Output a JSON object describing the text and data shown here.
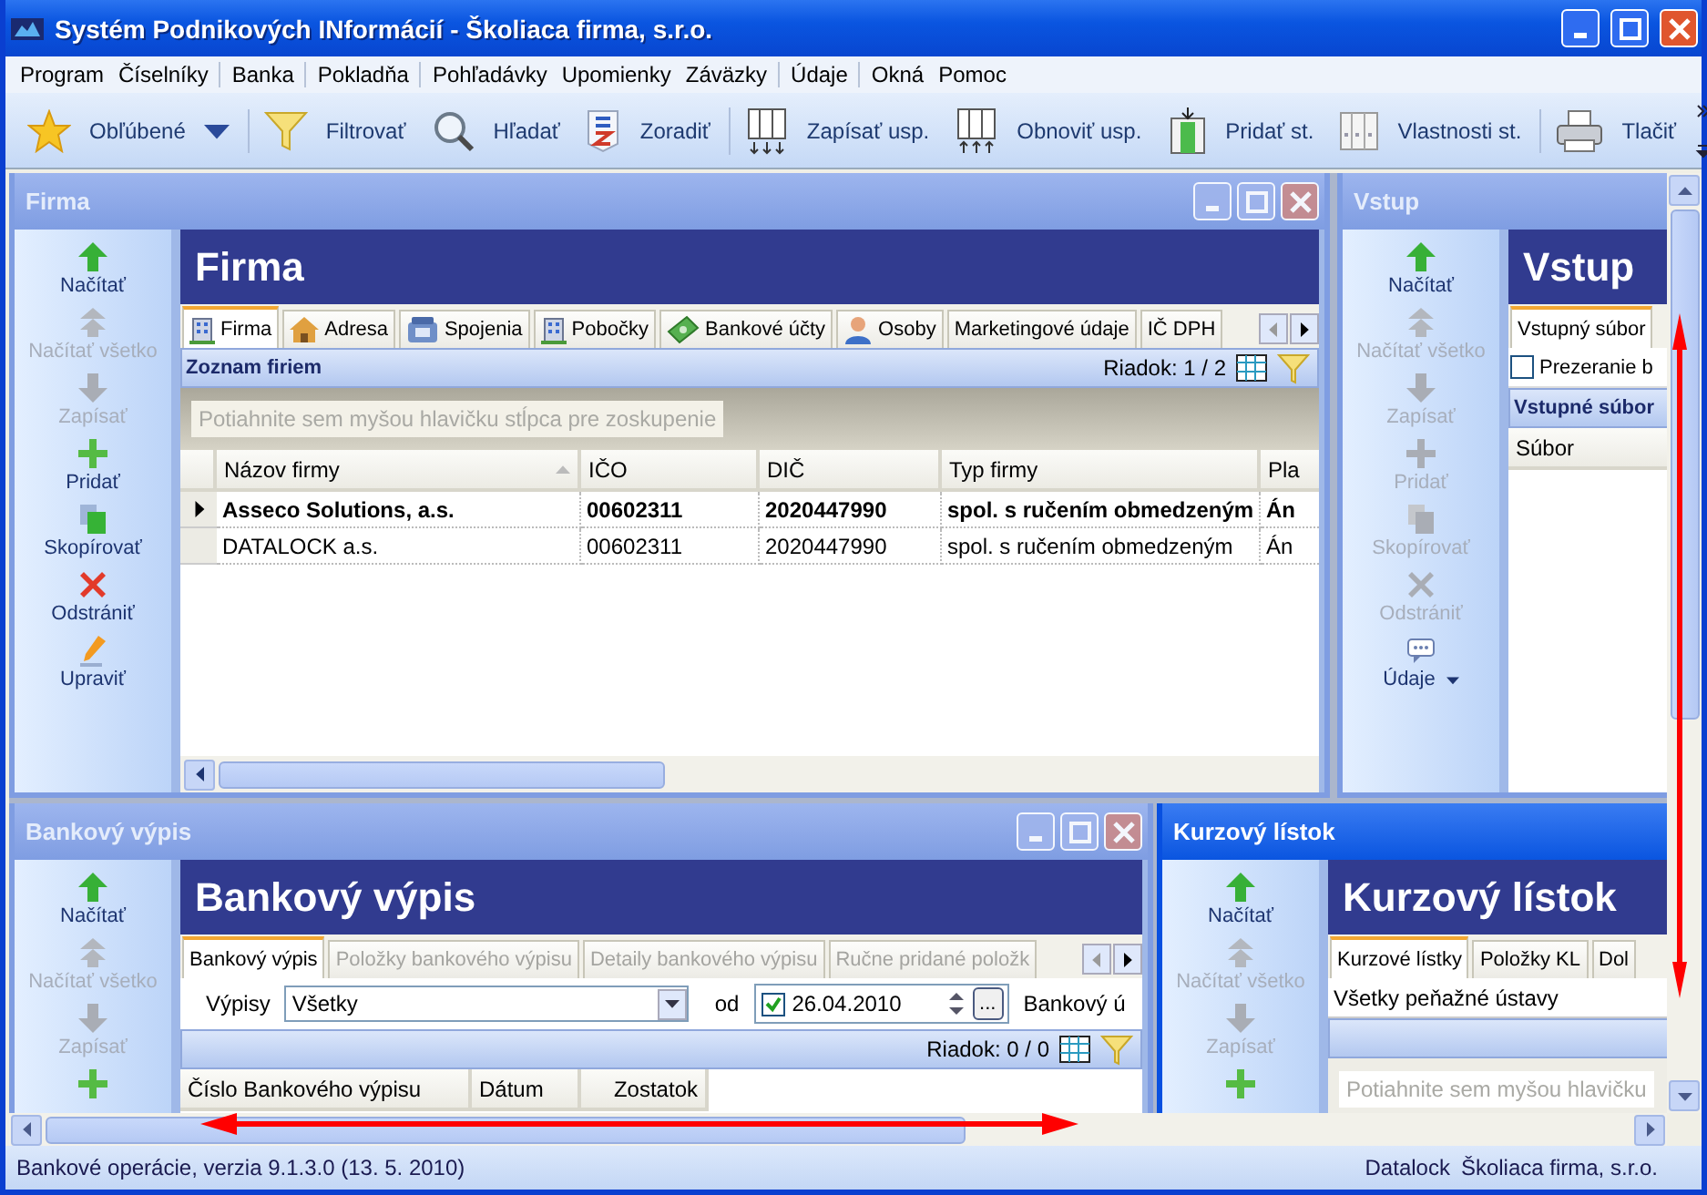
{
  "window": {
    "title": "Systém Podnikových INformácií - Školiaca firma, s.r.o."
  },
  "menu": [
    {
      "label": "Program",
      "separator": false
    },
    {
      "label": "Číselníky",
      "separator": false
    },
    {
      "label": "Banka",
      "separator": true
    },
    {
      "label": "Pokladňa",
      "separator": true
    },
    {
      "label": "Pohľadávky",
      "separator": true
    },
    {
      "label": "Upomienky",
      "separator": false
    },
    {
      "label": "Záväzky",
      "separator": false
    },
    {
      "label": "Údaje",
      "separator": true
    },
    {
      "label": "Okná",
      "separator": true
    },
    {
      "label": "Pomoc",
      "separator": false
    }
  ],
  "toolbar": [
    {
      "kind": "star",
      "label": "Obľúbené",
      "dropdown": true,
      "separator": false
    },
    {
      "kind": "filter",
      "label": "Filtrovať",
      "dropdown": false,
      "separator": true
    },
    {
      "kind": "search",
      "label": "Hľadať",
      "dropdown": false,
      "separator": false
    },
    {
      "kind": "sort",
      "label": "Zoradiť",
      "dropdown": false,
      "separator": false
    },
    {
      "kind": "save-columns",
      "label": "Zapísať usp.",
      "dropdown": false,
      "separator": true
    },
    {
      "kind": "restore-columns",
      "label": "Obnoviť usp.",
      "dropdown": false,
      "separator": false
    },
    {
      "kind": "add-column",
      "label": "Pridať st.",
      "dropdown": false,
      "separator": false
    },
    {
      "kind": "column-props",
      "label": "Vlastnosti st.",
      "dropdown": false,
      "separator": false
    },
    {
      "kind": "print",
      "label": "Tlačiť",
      "dropdown": false,
      "separator": true
    }
  ],
  "windows": [
    {
      "kind": "firma",
      "title": "Firma",
      "active": false,
      "controls": true,
      "header": "Firma",
      "actions": [
        {
          "kind": "load",
          "label": "Načítať",
          "disabled": false
        },
        {
          "kind": "load-all",
          "label": "Načítať všetko",
          "disabled": true
        },
        {
          "kind": "save",
          "label": "Zapísať",
          "disabled": true
        },
        {
          "kind": "add",
          "label": "Pridať",
          "disabled": false
        },
        {
          "kind": "copy",
          "label": "Skopírovať",
          "disabled": false
        },
        {
          "kind": "delete",
          "label": "Odstrániť",
          "disabled": false
        },
        {
          "kind": "edit",
          "label": "Upraviť",
          "disabled": false
        }
      ],
      "tabs": [
        {
          "kind": "building",
          "label": "Firma",
          "selected": true
        },
        {
          "kind": "house",
          "label": "Adresa",
          "selected": false
        },
        {
          "kind": "phone",
          "label": "Spojenia",
          "selected": false
        },
        {
          "kind": "building",
          "label": "Pobočky",
          "selected": false
        },
        {
          "kind": "money",
          "label": "Bankové účty",
          "selected": false
        },
        {
          "kind": "person",
          "label": "Osoby",
          "selected": false
        },
        {
          "kind": "plain",
          "label": "Marketingové údaje",
          "selected": false
        },
        {
          "kind": "plain",
          "label": "IČ DPH",
          "selected": false
        }
      ],
      "section": "Zoznam firiem",
      "row_count": "Riadok: 1 / 2",
      "group_hint": "Potiahnite sem myšou hlavičku stĺpca pre zoskupenie",
      "columns": [
        "Názov firmy",
        "IČO",
        "DIČ",
        "Typ firmy",
        "Pla"
      ],
      "rows": [
        {
          "selected": true,
          "cells": [
            "Asseco Solutions, a.s.",
            "00602311",
            "2020447990",
            "spol. s ručením obmedzeným",
            "Án"
          ]
        },
        {
          "selected": false,
          "cells": [
            "DATALOCK a.s.",
            "00602311",
            "2020447990",
            "spol. s ručením obmedzeným",
            "Án"
          ]
        }
      ]
    },
    {
      "kind": "vstup",
      "title": "Vstup",
      "active": false,
      "controls": false,
      "header": "Vstup",
      "actions": [
        {
          "kind": "load",
          "label": "Načítať",
          "disabled": false
        },
        {
          "kind": "load-all",
          "label": "Načítať všetko",
          "disabled": true
        },
        {
          "kind": "save",
          "label": "Zapísať",
          "disabled": true
        },
        {
          "kind": "add",
          "label": "Pridať",
          "disabled": true
        },
        {
          "kind": "copy",
          "label": "Skopírovať",
          "disabled": true
        },
        {
          "kind": "delete",
          "label": "Odstrániť",
          "disabled": true
        },
        {
          "kind": "data",
          "label": "Údaje",
          "disabled": false
        }
      ],
      "tabs": [
        {
          "kind": "plain",
          "label": "Vstupný súbor",
          "selected": true
        }
      ],
      "checkbox": {
        "label": "Prezeranie b",
        "checked": false
      },
      "section": "Vstupné súbor",
      "columns": [
        "Súbor"
      ]
    },
    {
      "kind": "bank",
      "title": "Bankový výpis",
      "active": false,
      "controls": true,
      "header": "Bankový výpis",
      "actions": [
        {
          "kind": "load",
          "label": "Načítať",
          "disabled": false
        },
        {
          "kind": "load-all",
          "label": "Načítať všetko",
          "disabled": true
        },
        {
          "kind": "save",
          "label": "Zapísať",
          "disabled": true
        },
        {
          "kind": "add",
          "disabled": false
        }
      ],
      "tabs": [
        {
          "kind": "plain",
          "label": "Bankový výpis",
          "selected": true,
          "disabled": false
        },
        {
          "kind": "plain",
          "label": "Položky bankového výpisu",
          "selected": false,
          "disabled": true
        },
        {
          "kind": "plain",
          "label": "Detaily bankového výpisu",
          "selected": false,
          "disabled": true
        },
        {
          "kind": "plain",
          "label": "Ručne pridané položk",
          "selected": false,
          "disabled": true
        }
      ],
      "filter": {
        "label": "Výpisy",
        "value": "Všetky",
        "date_label": "od",
        "date_checked": true,
        "date": "26.04.2010",
        "date_button": "...",
        "account_label": "Bankový ú"
      },
      "row_count": "Riadok: 0 / 0",
      "columns": [
        "Číslo Bankového výpisu",
        "Dátum",
        "Zostatok"
      ]
    },
    {
      "kind": "rates",
      "title": "Kurzový lístok",
      "active": true,
      "controls": false,
      "header": "Kurzový lístok",
      "actions": [
        {
          "kind": "load",
          "label": "Načítať",
          "disabled": false
        },
        {
          "kind": "load-all",
          "label": "Načítať všetko",
          "disabled": true
        },
        {
          "kind": "save",
          "label": "Zapísať",
          "disabled": true
        },
        {
          "kind": "add",
          "disabled": false
        }
      ],
      "tabs": [
        {
          "kind": "plain",
          "label": "Kurzové lístky",
          "selected": true
        },
        {
          "kind": "plain",
          "label": "Položky KL",
          "selected": false
        },
        {
          "kind": "plain",
          "label": "Dol",
          "selected": false
        }
      ],
      "field": "Všetky peňažné ústavy",
      "group_hint": "Potiahnite sem myšou hlavičku"
    }
  ],
  "status_bar": {
    "left": "Bankové operácie, verzia 9.1.3.0 (13. 5. 2010)",
    "user": "Datalock",
    "company": "Školiaca firma, s.r.o."
  }
}
